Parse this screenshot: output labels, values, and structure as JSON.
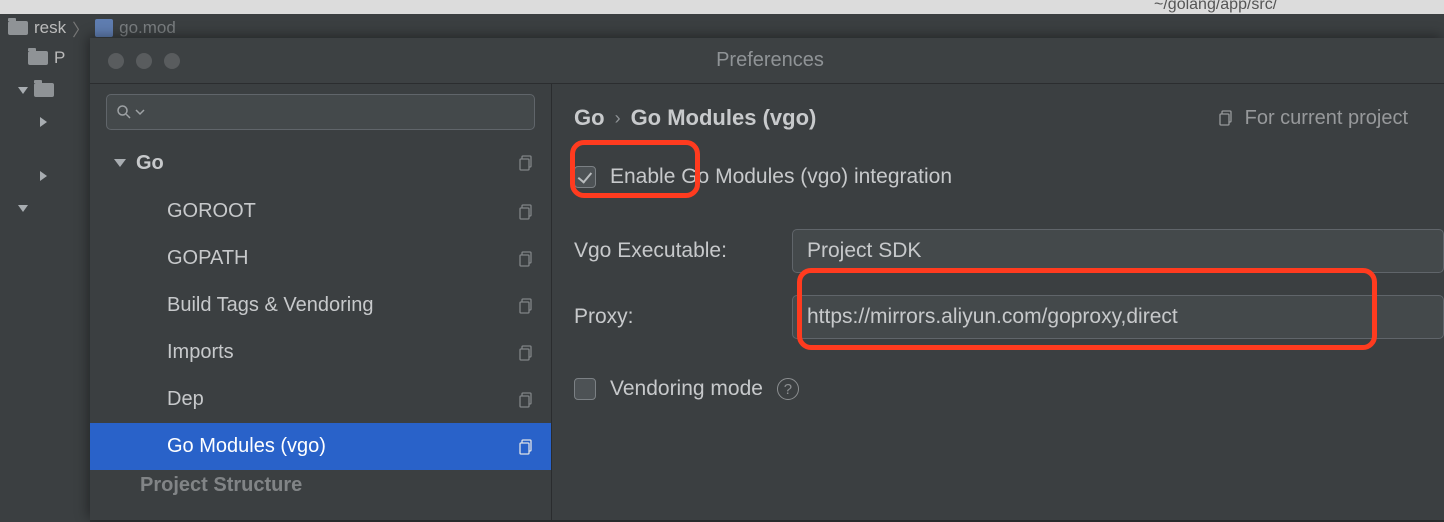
{
  "background": {
    "project_name": "resk",
    "open_file": "go.mod",
    "status_path": "~/golang/app/src/",
    "tree_label": "P"
  },
  "dialog": {
    "title": "Preferences",
    "scope_label": "For current project"
  },
  "sidebar": {
    "group": "Go",
    "items": [
      "GOROOT",
      "GOPATH",
      "Build Tags & Vendoring",
      "Imports",
      "Dep",
      "Go Modules (vgo)"
    ],
    "next_group": "Project Structure"
  },
  "crumbs": {
    "c1": "Go",
    "c2": "Go Modules (vgo)"
  },
  "form": {
    "enable_label": "Enable Go Modules (vgo) integration",
    "vgo_exec_label": "Vgo Executable:",
    "vgo_exec_value": "Project SDK",
    "proxy_label": "Proxy:",
    "proxy_value": "https://mirrors.aliyun.com/goproxy,direct",
    "vendoring_label": "Vendoring mode"
  }
}
